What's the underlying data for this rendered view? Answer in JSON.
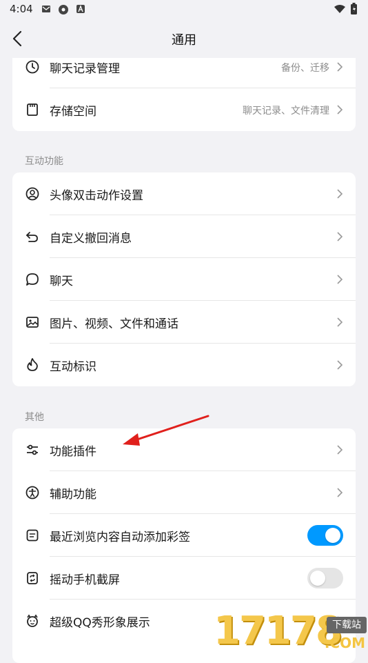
{
  "status": {
    "time": "4:04"
  },
  "header": {
    "title": "通用"
  },
  "top_card": [
    {
      "label": "聊天记录管理",
      "hint": "备份、迁移",
      "icon": "clock-icon"
    },
    {
      "label": "存储空间",
      "hint": "聊天记录、文件清理",
      "icon": "storage-icon"
    }
  ],
  "section_interaction": {
    "title": "互动功能",
    "items": [
      {
        "label": "头像双击动作设置",
        "icon": "avatar-icon"
      },
      {
        "label": "自定义撤回消息",
        "icon": "undo-icon"
      },
      {
        "label": "聊天",
        "icon": "chat-bubble-icon"
      },
      {
        "label": "图片、视频、文件和通话",
        "icon": "image-icon"
      },
      {
        "label": "互动标识",
        "icon": "flame-icon"
      }
    ]
  },
  "section_other": {
    "title": "其他",
    "items": [
      {
        "label": "功能插件",
        "icon": "sliders-icon"
      },
      {
        "label": "辅助功能",
        "icon": "accessibility-icon"
      },
      {
        "label": "最近浏览内容自动添加彩签",
        "icon": "tag-icon",
        "toggle": true
      },
      {
        "label": "摇动手机截屏",
        "icon": "shake-icon",
        "toggle": false
      },
      {
        "label": "超级QQ秀形象展示",
        "icon": "qq-show-icon"
      }
    ]
  },
  "watermark": {
    "number": "17178",
    "tag": "下载站",
    "domain": ".COM"
  },
  "colors": {
    "accent": "#0099ff",
    "background": "#f2f2f5",
    "annotation_arrow": "#e0201c"
  }
}
